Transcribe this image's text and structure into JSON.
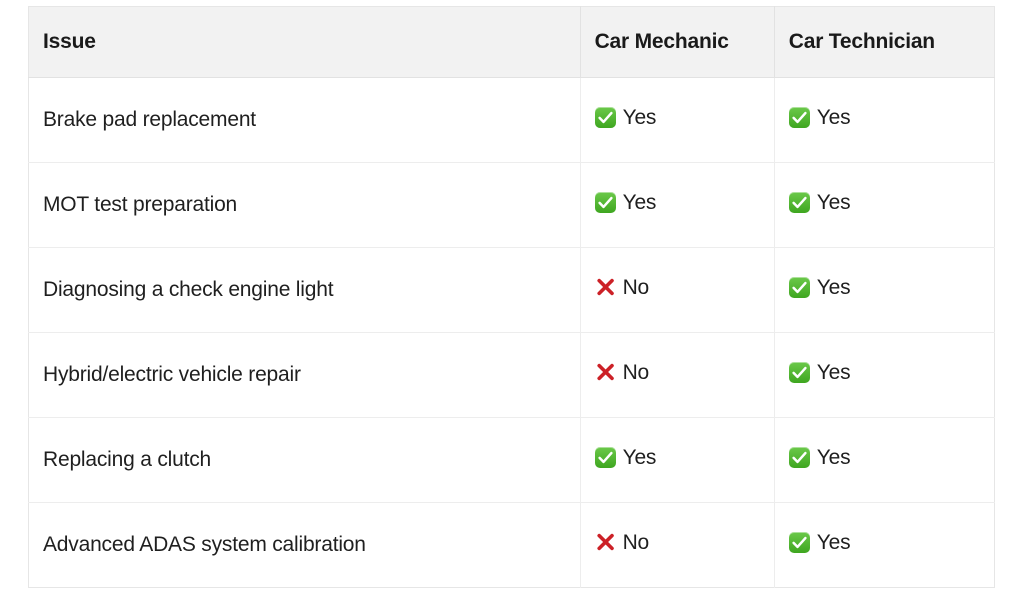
{
  "table": {
    "columns": [
      {
        "key": "issue",
        "label": "Issue"
      },
      {
        "key": "mechanic",
        "label": "Car Mechanic"
      },
      {
        "key": "technician",
        "label": "Car Technician"
      }
    ],
    "rows": [
      {
        "issue": "Brake pad replacement",
        "mechanic": {
          "icon": "check-mark-icon",
          "label": "Yes"
        },
        "technician": {
          "icon": "check-mark-icon",
          "label": "Yes"
        }
      },
      {
        "issue": "MOT test preparation",
        "mechanic": {
          "icon": "check-mark-icon",
          "label": "Yes"
        },
        "technician": {
          "icon": "check-mark-icon",
          "label": "Yes"
        }
      },
      {
        "issue": "Diagnosing a check engine light",
        "mechanic": {
          "icon": "cross-mark-icon",
          "label": "No"
        },
        "technician": {
          "icon": "check-mark-icon",
          "label": "Yes"
        }
      },
      {
        "issue": "Hybrid/electric vehicle repair",
        "mechanic": {
          "icon": "cross-mark-icon",
          "label": "No"
        },
        "technician": {
          "icon": "check-mark-icon",
          "label": "Yes"
        }
      },
      {
        "issue": "Replacing a clutch",
        "mechanic": {
          "icon": "check-mark-icon",
          "label": "Yes"
        },
        "technician": {
          "icon": "check-mark-icon",
          "label": "Yes"
        }
      },
      {
        "issue": "Advanced ADAS system calibration",
        "mechanic": {
          "icon": "cross-mark-icon",
          "label": "No"
        },
        "technician": {
          "icon": "check-mark-icon",
          "label": "Yes"
        }
      }
    ]
  },
  "colors": {
    "header_background": "#f2f2f2",
    "border": "#e6e6e6",
    "row_border": "#ededed",
    "text": "#1f1f1f",
    "check_green": "#4cae2a",
    "cross_red": "#cc2127",
    "page_background": "#ffffff"
  }
}
